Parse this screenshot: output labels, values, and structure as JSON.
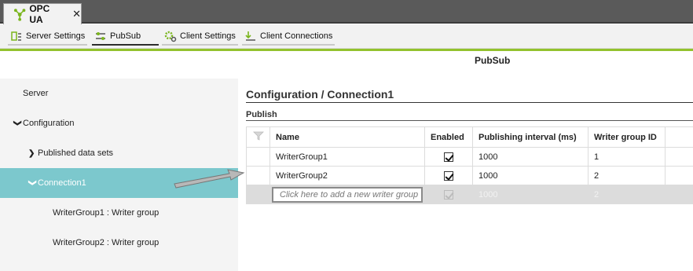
{
  "tabs": [
    {
      "label": "OPC UA",
      "icon": "network-nodes-icon",
      "close": "✕"
    }
  ],
  "toolbar": {
    "buttons": [
      {
        "label": "Server Settings",
        "icon": "server-settings-icon"
      },
      {
        "label": "PubSub",
        "icon": "pubsub-icon"
      },
      {
        "label": "Client Settings",
        "icon": "client-settings-icon"
      },
      {
        "label": "Client Connections",
        "icon": "client-connections-icon"
      }
    ],
    "accent": "#93c22d"
  },
  "page": {
    "title": "PubSub"
  },
  "sidebar": {
    "items": [
      {
        "label": "Server"
      },
      {
        "label": "Configuration"
      },
      {
        "label": "Published data sets"
      },
      {
        "label": "Connection1"
      },
      {
        "label": "WriterGroup1 : Writer group"
      },
      {
        "label": "WriterGroup2 : Writer group"
      }
    ],
    "selected_color": "#7cc8cd"
  },
  "main": {
    "breadcrumb": "Configuration / Connection1",
    "section_label": "Publish",
    "table": {
      "headers": [
        "Name",
        "Enabled",
        "Publishing interval (ms)",
        "Writer group ID"
      ],
      "rows": [
        {
          "name": "WriterGroup1",
          "enabled": true,
          "interval": "1000",
          "id": "1"
        },
        {
          "name": "WriterGroup2",
          "enabled": true,
          "interval": "1000",
          "id": "2"
        }
      ],
      "new_row": {
        "placeholder": "Click here to add a new writer group",
        "interval": "1000",
        "id": "2"
      }
    }
  }
}
